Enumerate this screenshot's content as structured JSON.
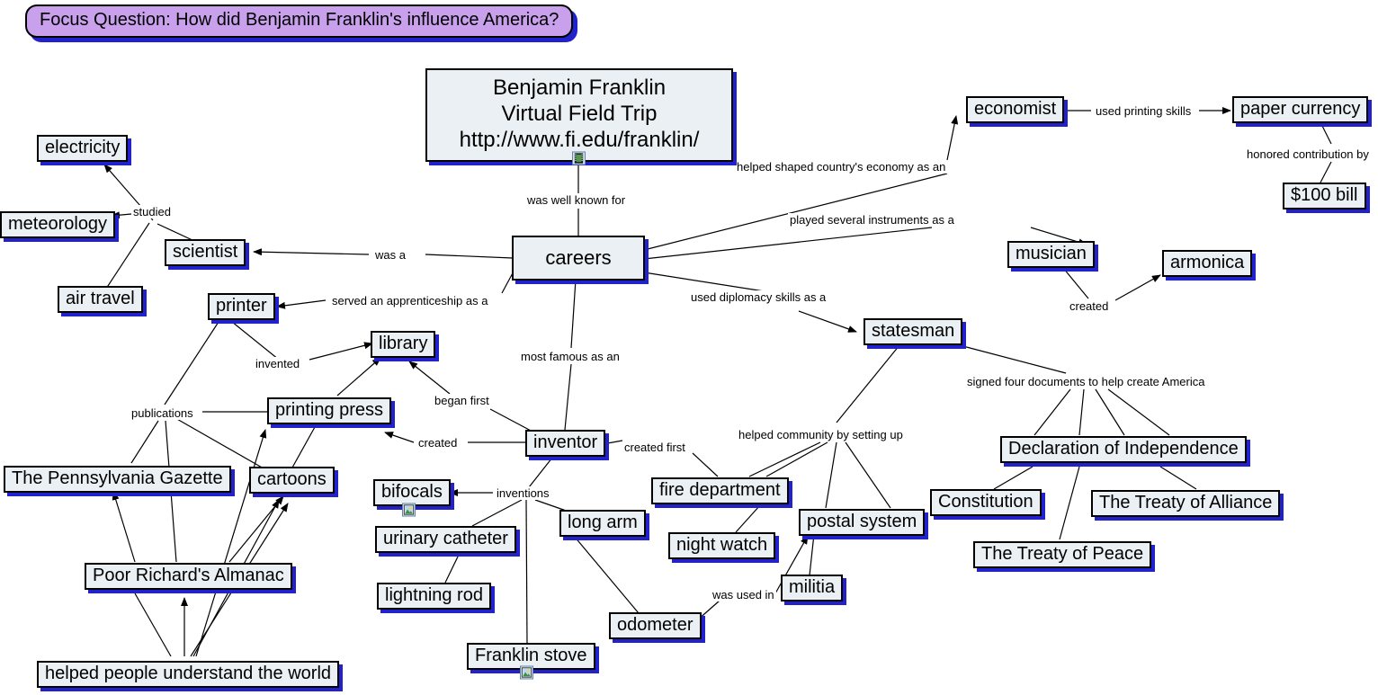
{
  "focus_question": {
    "text": "Focus Question: How did Benjamin Franklin's influence America?"
  },
  "colors": {
    "node_fill": "#eaf0f3",
    "node_border": "#000000",
    "node_shadow": "#2222cc",
    "focus_fill": "#c9a0ec",
    "edge": "#000000",
    "canvas": "#ffffff"
  },
  "root": {
    "line1": "Benjamin Franklin",
    "line2": "Virtual Field Trip",
    "line3": "http://www.fi.edu/franklin/",
    "icon": "film-strip-icon"
  },
  "nodes": [
    {
      "id": "careers",
      "label": "careers"
    },
    {
      "id": "electricity",
      "label": "electricity"
    },
    {
      "id": "meteorology",
      "label": "meteorology"
    },
    {
      "id": "air_travel",
      "label": "air travel"
    },
    {
      "id": "scientist",
      "label": "scientist"
    },
    {
      "id": "printer",
      "label": "printer"
    },
    {
      "id": "library",
      "label": "library"
    },
    {
      "id": "printing_press",
      "label": "printing press"
    },
    {
      "id": "cartoons",
      "label": "cartoons"
    },
    {
      "id": "gazette",
      "label": "The Pennsylvania Gazette"
    },
    {
      "id": "almanac",
      "label": "Poor Richard's Almanac"
    },
    {
      "id": "understand",
      "label": "helped people understand the world"
    },
    {
      "id": "inventor",
      "label": "inventor"
    },
    {
      "id": "bifocals",
      "label": "bifocals",
      "icon": "picture-icon"
    },
    {
      "id": "catheter",
      "label": "urinary catheter"
    },
    {
      "id": "lightning_rod",
      "label": "lightning rod"
    },
    {
      "id": "long_arm",
      "label": "long arm"
    },
    {
      "id": "stove",
      "label": "Franklin stove",
      "icon": "picture-icon"
    },
    {
      "id": "odometer",
      "label": "odometer"
    },
    {
      "id": "economist",
      "label": "economist"
    },
    {
      "id": "paper_currency",
      "label": "paper currency"
    },
    {
      "id": "hundred_bill",
      "label": "$100 bill"
    },
    {
      "id": "musician",
      "label": "musician"
    },
    {
      "id": "armonica",
      "label": "armonica"
    },
    {
      "id": "statesman",
      "label": "statesman"
    },
    {
      "id": "fire_dept",
      "label": "fire department"
    },
    {
      "id": "night_watch",
      "label": "night watch"
    },
    {
      "id": "postal",
      "label": "postal system"
    },
    {
      "id": "militia",
      "label": "militia"
    },
    {
      "id": "declaration",
      "label": "Declaration of Independence"
    },
    {
      "id": "constitution",
      "label": "Constitution"
    },
    {
      "id": "treaty_peace",
      "label": "The Treaty of Peace"
    },
    {
      "id": "treaty_alliance",
      "label": "The Treaty of Alliance"
    }
  ],
  "edge_labels": [
    {
      "id": "l_known",
      "text": "was well known for"
    },
    {
      "id": "l_economy",
      "text": "helped shaped country's economy as an"
    },
    {
      "id": "l_instruments",
      "text": "played several instruments as a"
    },
    {
      "id": "l_diplomacy",
      "text": "used diplomacy skills  as a"
    },
    {
      "id": "l_wasa",
      "text": "was a"
    },
    {
      "id": "l_apprentice",
      "text": "served an apprenticeship as a"
    },
    {
      "id": "l_famous",
      "text": "most famous as an"
    },
    {
      "id": "l_studied",
      "text": "studied"
    },
    {
      "id": "l_invented",
      "text": "invented"
    },
    {
      "id": "l_publications",
      "text": "publications"
    },
    {
      "id": "l_began",
      "text": "began first"
    },
    {
      "id": "l_created_pp",
      "text": "created"
    },
    {
      "id": "l_inventions",
      "text": "inventions"
    },
    {
      "id": "l_createdfirst",
      "text": "created first"
    },
    {
      "id": "l_community",
      "text": "helped community by setting up"
    },
    {
      "id": "l_wasused",
      "text": "was used in"
    },
    {
      "id": "l_signed",
      "text": "signed four documents to help create America"
    },
    {
      "id": "l_printskills",
      "text": "used printing skills"
    },
    {
      "id": "l_honored",
      "text": "honored contribution by"
    },
    {
      "id": "l_created_arm",
      "text": "created"
    }
  ]
}
